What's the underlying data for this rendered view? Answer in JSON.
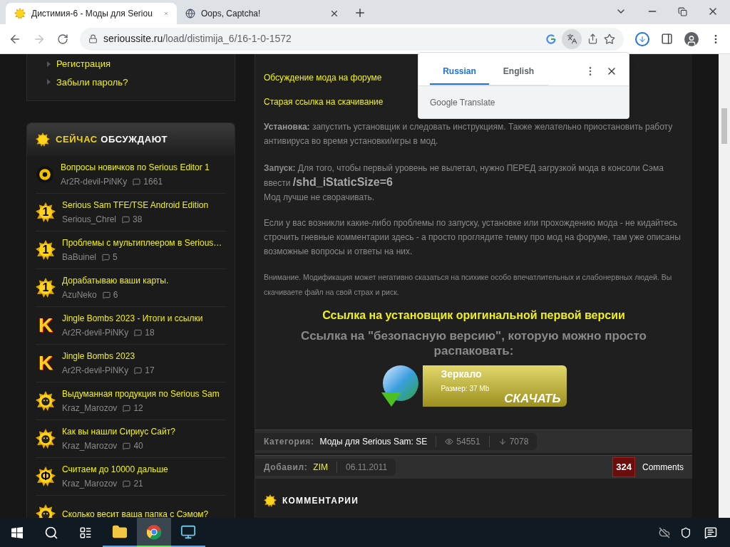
{
  "browser": {
    "tabs": [
      {
        "title": "Дистимия-6 - Моды для Seriou",
        "selected": true,
        "kind": "site"
      },
      {
        "title": "Oops, Captcha!",
        "selected": false,
        "kind": "generic"
      }
    ],
    "url_host": "serioussite.ru",
    "url_path": "/load/distimija_6/16-1-0-1572"
  },
  "translate_popup": {
    "tabs": [
      {
        "label": "Russian",
        "selected": true
      },
      {
        "label": "English",
        "selected": false
      }
    ],
    "brand": "Google Translate"
  },
  "sidebar": {
    "account_links": [
      "Регистрация",
      "Забыли пароль?"
    ],
    "discussion": {
      "title_accent": "СЕЙЧАС",
      "title_rest": "ОБСУЖДАЮТ",
      "items": [
        {
          "title": "Вопросы новичков по Serious Editor 1",
          "author": "Ar2R-devil-PiNKy",
          "comments": "1661",
          "avatar": {
            "kind": "ring"
          }
        },
        {
          "title": "Serious Sam TFE/TSE Android Edition",
          "author": "Serious_Chrel",
          "comments": "38",
          "avatar": {
            "kind": "sun",
            "glyph": "1"
          }
        },
        {
          "title": "Проблемы с мультиплеером в Serious…",
          "author": "BaBuinel",
          "comments": "5",
          "avatar": {
            "kind": "sun",
            "glyph": "1"
          }
        },
        {
          "title": "Дорабатываю ваши карты.",
          "author": "AzuNeko",
          "comments": "6",
          "avatar": {
            "kind": "sun",
            "glyph": "1"
          }
        },
        {
          "title": "Jingle Bombs 2023 - Итоги и ссылки",
          "author": "Ar2R-devil-PiNKy",
          "comments": "18",
          "avatar": {
            "kind": "letter",
            "glyph": "K"
          }
        },
        {
          "title": "Jingle Bombs 2023",
          "author": "Ar2R-devil-PiNKy",
          "comments": "17",
          "avatar": {
            "kind": "letter",
            "glyph": "K"
          }
        },
        {
          "title": "Выдуманная продукция по Serious Sam",
          "author": "Kraz_Marozov",
          "comments": "12",
          "avatar": {
            "kind": "face"
          }
        },
        {
          "title": "Как вы нашли Сириус Сайт?",
          "author": "Kraz_Marozov",
          "comments": "40",
          "avatar": {
            "kind": "face"
          }
        },
        {
          "title": "Считаем до 10000 дальше",
          "author": "Kraz_Marozov",
          "comments": "21",
          "avatar": {
            "kind": "sun",
            "glyph": "Ф"
          }
        },
        {
          "title": "Сколько весит ваша папка с Сэмом?",
          "avatar": {
            "kind": "face"
          }
        }
      ]
    }
  },
  "article": {
    "links": [
      "Обсуждение мода на форуме",
      "Старая ссылка на скачивание"
    ],
    "paragraphs": [
      {
        "kind": "text",
        "text": "**Установка:** запустить установщик и следовать инструкциям. Также желательно приостановить работу антивируса во время установки/игры в мод."
      },
      {
        "kind": "command",
        "text": "**Запуск:** Для того, чтобы первый уровень не вылетал, нужно ПЕРЕД загрузкой мода в консоли Сэма ввести",
        "command": "/shd_iStaticSize=6",
        "after": "Мод лучше не сворачивать."
      },
      {
        "kind": "text",
        "text": "Если у вас возникли какие-либо проблемы по запуску, установке или прохождению мода - не кидайтесь строчить гневные комментарии здесь - а просто проглядите темку про мод на форуме, там уже описаны возможные вопросы и ответы на них."
      },
      {
        "kind": "small",
        "text": "Внимание. Модификация может негативно сказаться на психике особо впечатлительных и слабонервных людей. Вы скачиваете файл на свой страх и риск."
      }
    ],
    "installer_link": "Ссылка на установщик оригинальной первой версии",
    "safe_version_text": "Ссылка на \"безопасную версию\", которую можно просто распаковать:",
    "download": {
      "title": "Зеркало",
      "size": "Размер: 37 Mb",
      "action": "СКАЧАТЬ"
    },
    "category_label": "Категория:",
    "category": "Моды для Serious Sam: SE",
    "views": "54551",
    "downloads": "7078",
    "added_label": "Добавил:",
    "added_by": "ZIM",
    "date": "06.11.2011",
    "comment_count": "324",
    "comments_label": "Comments",
    "comments_heading": "КОММЕНТАРИИ"
  },
  "taskbar": {
    "apps": [
      {
        "kind": "folder",
        "active": false
      },
      {
        "kind": "chrome",
        "active": true
      },
      {
        "kind": "app",
        "active": false
      }
    ]
  }
}
